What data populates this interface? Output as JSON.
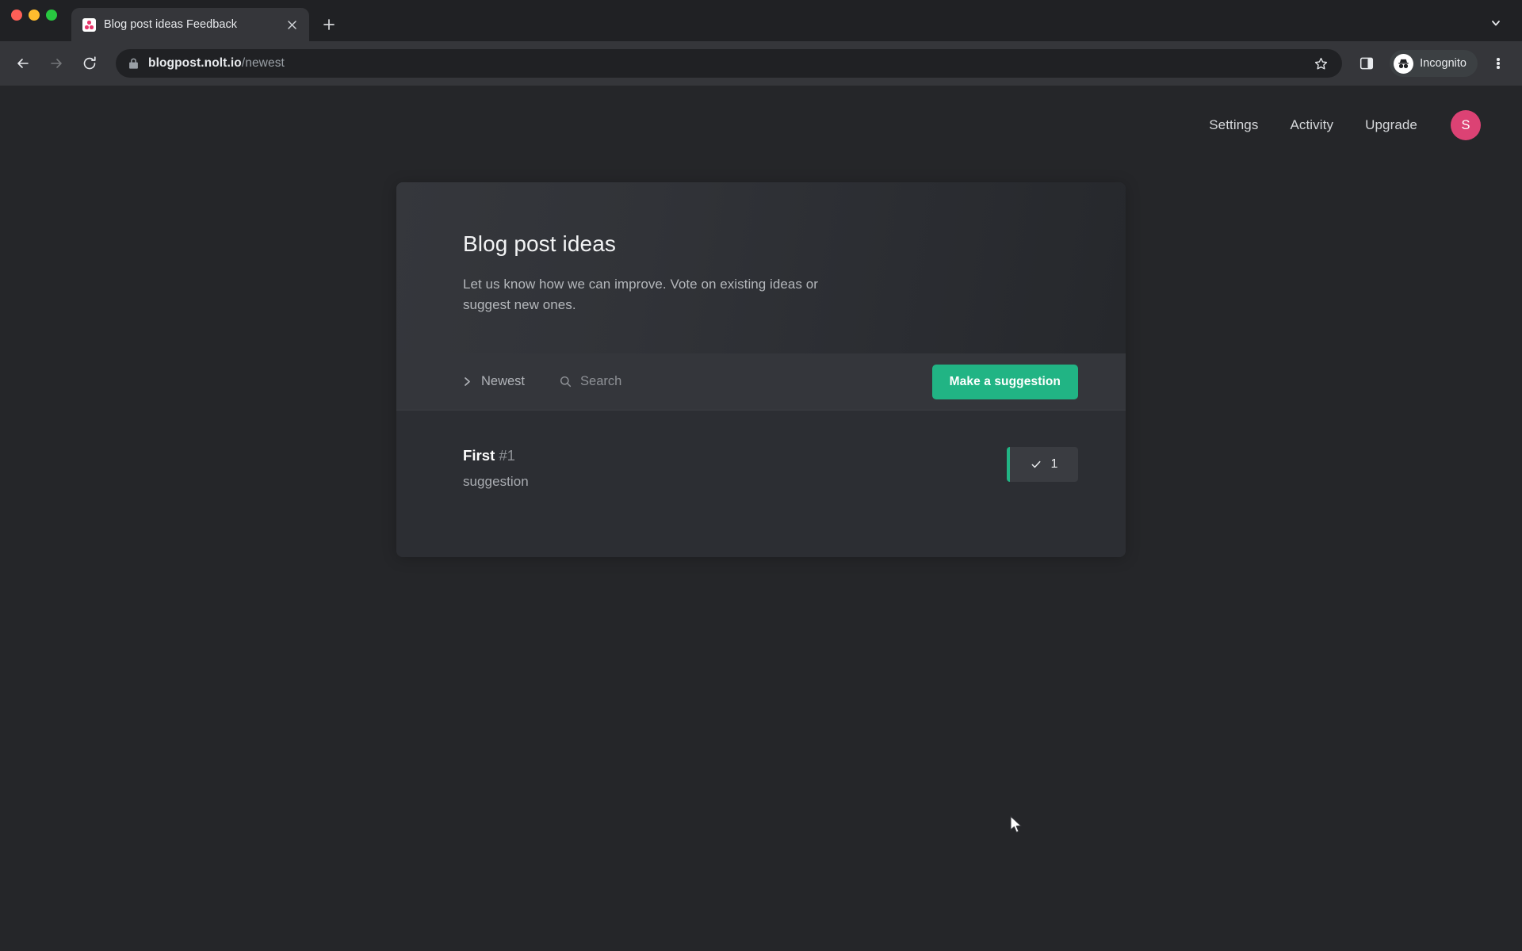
{
  "browser": {
    "window_controls": [
      "close",
      "minimize",
      "maximize"
    ],
    "tab": {
      "title": "Blog post ideas Feedback",
      "favicon": "nolt-logo-icon",
      "close_icon": "close-icon"
    },
    "new_tab_label": "+",
    "tab_search_icon": "chevron-down-icon",
    "nav": {
      "back_icon": "arrow-left-icon",
      "forward_icon": "arrow-right-icon",
      "reload_icon": "reload-icon"
    },
    "omnibox": {
      "lock_icon": "lock-icon",
      "url_host": "blogpost.nolt.io",
      "url_path": "/newest",
      "bookmark_icon": "star-icon"
    },
    "side_panel_icon": "side-panel-icon",
    "incognito": {
      "label": "Incognito",
      "icon": "incognito-icon"
    },
    "menu_icon": "kebab-menu-icon"
  },
  "site": {
    "nav_links": [
      {
        "label": "Settings"
      },
      {
        "label": "Activity"
      },
      {
        "label": "Upgrade"
      }
    ],
    "avatar": {
      "initial": "S",
      "color": "#dc4274"
    }
  },
  "board": {
    "title": "Blog post ideas",
    "subtitle": "Let us know how we can improve. Vote on existing ideas or suggest new ones.",
    "toolbar": {
      "sort": {
        "label": "Newest",
        "icon": "chevron-right-icon"
      },
      "search": {
        "label": "Search",
        "placeholder": "Search",
        "icon": "search-icon"
      },
      "suggest_button": {
        "label": "Make a suggestion",
        "color": "#21b484"
      }
    },
    "items": [
      {
        "title": "First",
        "number": "#1",
        "description": "suggestion",
        "votes": "1",
        "vote_icon": "check-icon",
        "voted_accent": "#21b484"
      }
    ]
  },
  "colors": {
    "page_background": "#252629",
    "card_background": "#2c2e33",
    "accent_green": "#21b484",
    "accent_pink": "#dc4274"
  }
}
